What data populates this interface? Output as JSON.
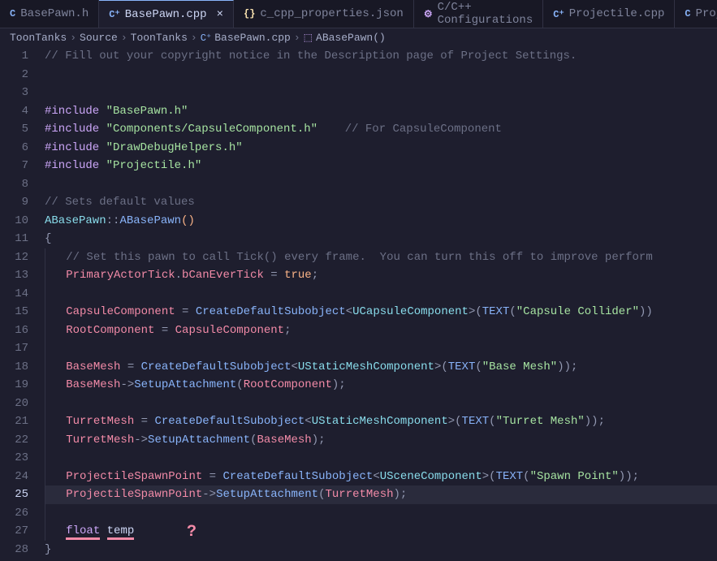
{
  "tabs": [
    {
      "icon": "C",
      "label": "BasePawn.h",
      "active": false
    },
    {
      "icon": "C⁺",
      "label": "BasePawn.cpp",
      "active": true,
      "close": "×"
    },
    {
      "icon": "{}",
      "label": "c_cpp_properties.json",
      "active": false
    },
    {
      "icon": "⚙",
      "label": "C/C++ Configurations",
      "active": false
    },
    {
      "icon": "C⁺",
      "label": "Projectile.cpp",
      "active": false
    },
    {
      "icon": "C",
      "label": "Projectile.",
      "active": false
    }
  ],
  "breadcrumb": {
    "parts": [
      "ToonTanks",
      "Source",
      "ToonTanks"
    ],
    "file": "BasePawn.cpp",
    "symbol": "ABasePawn()"
  },
  "code": {
    "lines": [
      {
        "n": 1,
        "tokens": [
          {
            "t": "// Fill out your copyright notice in the Description page of Project Settings.",
            "c": "comment"
          }
        ]
      },
      {
        "n": 2,
        "tokens": []
      },
      {
        "n": 3,
        "tokens": []
      },
      {
        "n": 4,
        "tokens": [
          {
            "t": "#include ",
            "c": "preprocessor"
          },
          {
            "t": "\"BasePawn.h\"",
            "c": "string"
          }
        ]
      },
      {
        "n": 5,
        "tokens": [
          {
            "t": "#include ",
            "c": "preprocessor"
          },
          {
            "t": "\"Components/CapsuleComponent.h\"",
            "c": "string"
          },
          {
            "t": "    ",
            "c": ""
          },
          {
            "t": "// For CapsuleComponent",
            "c": "comment"
          }
        ]
      },
      {
        "n": 6,
        "tokens": [
          {
            "t": "#include ",
            "c": "preprocessor"
          },
          {
            "t": "\"DrawDebugHelpers.h\"",
            "c": "string"
          }
        ]
      },
      {
        "n": 7,
        "tokens": [
          {
            "t": "#include ",
            "c": "preprocessor"
          },
          {
            "t": "\"Projectile.h\"",
            "c": "string"
          }
        ]
      },
      {
        "n": 8,
        "tokens": []
      },
      {
        "n": 9,
        "tokens": [
          {
            "t": "// Sets default values",
            "c": "comment"
          }
        ]
      },
      {
        "n": 10,
        "tokens": [
          {
            "t": "ABasePawn",
            "c": "class-name"
          },
          {
            "t": "::",
            "c": "punct"
          },
          {
            "t": "ABasePawn",
            "c": "func"
          },
          {
            "t": "()",
            "c": "literal"
          }
        ]
      },
      {
        "n": 11,
        "tokens": [
          {
            "t": "{",
            "c": "punct"
          }
        ]
      },
      {
        "n": 12,
        "indent": 1,
        "tokens": [
          {
            "t": "// Set this pawn to call Tick() every frame.  You can turn this off to improve perform",
            "c": "comment"
          }
        ]
      },
      {
        "n": 13,
        "indent": 1,
        "tokens": [
          {
            "t": "PrimaryActorTick",
            "c": "var"
          },
          {
            "t": ".",
            "c": "punct"
          },
          {
            "t": "bCanEverTick",
            "c": "var"
          },
          {
            "t": " = ",
            "c": "operator"
          },
          {
            "t": "true",
            "c": "literal"
          },
          {
            "t": ";",
            "c": "punct"
          }
        ]
      },
      {
        "n": 14,
        "indent": 1,
        "tokens": []
      },
      {
        "n": 15,
        "indent": 1,
        "tokens": [
          {
            "t": "CapsuleComponent",
            "c": "var"
          },
          {
            "t": " = ",
            "c": "operator"
          },
          {
            "t": "CreateDefaultSubobject",
            "c": "func"
          },
          {
            "t": "<",
            "c": "punct"
          },
          {
            "t": "UCapsuleComponent",
            "c": "class-name"
          },
          {
            "t": ">(",
            "c": "punct"
          },
          {
            "t": "TEXT",
            "c": "macro"
          },
          {
            "t": "(",
            "c": "punct"
          },
          {
            "t": "\"Capsule Collider\"",
            "c": "string"
          },
          {
            "t": "))",
            "c": "punct"
          }
        ]
      },
      {
        "n": 16,
        "indent": 1,
        "tokens": [
          {
            "t": "RootComponent",
            "c": "var"
          },
          {
            "t": " = ",
            "c": "operator"
          },
          {
            "t": "CapsuleComponent",
            "c": "var"
          },
          {
            "t": ";",
            "c": "punct"
          }
        ]
      },
      {
        "n": 17,
        "indent": 1,
        "tokens": []
      },
      {
        "n": 18,
        "indent": 1,
        "tokens": [
          {
            "t": "BaseMesh",
            "c": "var"
          },
          {
            "t": " = ",
            "c": "operator"
          },
          {
            "t": "CreateDefaultSubobject",
            "c": "func"
          },
          {
            "t": "<",
            "c": "punct"
          },
          {
            "t": "UStaticMeshComponent",
            "c": "class-name"
          },
          {
            "t": ">(",
            "c": "punct"
          },
          {
            "t": "TEXT",
            "c": "macro"
          },
          {
            "t": "(",
            "c": "punct"
          },
          {
            "t": "\"Base Mesh\"",
            "c": "string"
          },
          {
            "t": "));",
            "c": "punct"
          }
        ]
      },
      {
        "n": 19,
        "indent": 1,
        "tokens": [
          {
            "t": "BaseMesh",
            "c": "var"
          },
          {
            "t": "->",
            "c": "punct"
          },
          {
            "t": "SetupAttachment",
            "c": "func"
          },
          {
            "t": "(",
            "c": "punct"
          },
          {
            "t": "RootComponent",
            "c": "var"
          },
          {
            "t": ");",
            "c": "punct"
          }
        ]
      },
      {
        "n": 20,
        "indent": 1,
        "tokens": []
      },
      {
        "n": 21,
        "indent": 1,
        "tokens": [
          {
            "t": "TurretMesh",
            "c": "var"
          },
          {
            "t": " = ",
            "c": "operator"
          },
          {
            "t": "CreateDefaultSubobject",
            "c": "func"
          },
          {
            "t": "<",
            "c": "punct"
          },
          {
            "t": "UStaticMeshComponent",
            "c": "class-name"
          },
          {
            "t": ">(",
            "c": "punct"
          },
          {
            "t": "TEXT",
            "c": "macro"
          },
          {
            "t": "(",
            "c": "punct"
          },
          {
            "t": "\"Turret Mesh\"",
            "c": "string"
          },
          {
            "t": "));",
            "c": "punct"
          }
        ]
      },
      {
        "n": 22,
        "indent": 1,
        "tokens": [
          {
            "t": "TurretMesh",
            "c": "var"
          },
          {
            "t": "->",
            "c": "punct"
          },
          {
            "t": "SetupAttachment",
            "c": "func"
          },
          {
            "t": "(",
            "c": "punct"
          },
          {
            "t": "BaseMesh",
            "c": "var"
          },
          {
            "t": ");",
            "c": "punct"
          }
        ]
      },
      {
        "n": 23,
        "indent": 1,
        "tokens": []
      },
      {
        "n": 24,
        "indent": 1,
        "tokens": [
          {
            "t": "ProjectileSpawnPoint",
            "c": "var"
          },
          {
            "t": " = ",
            "c": "operator"
          },
          {
            "t": "CreateDefaultSubobject",
            "c": "func"
          },
          {
            "t": "<",
            "c": "punct"
          },
          {
            "t": "USceneComponent",
            "c": "class-name"
          },
          {
            "t": ">(",
            "c": "punct"
          },
          {
            "t": "TEXT",
            "c": "macro"
          },
          {
            "t": "(",
            "c": "punct"
          },
          {
            "t": "\"Spawn Point\"",
            "c": "string"
          },
          {
            "t": "));",
            "c": "punct"
          }
        ]
      },
      {
        "n": 25,
        "indent": 1,
        "cursor": true,
        "tokens": [
          {
            "t": "ProjectileSpawnPoint",
            "c": "var"
          },
          {
            "t": "->",
            "c": "punct"
          },
          {
            "t": "SetupAttachment",
            "c": "func"
          },
          {
            "t": "(",
            "c": "punct"
          },
          {
            "t": "TurretMesh",
            "c": "var"
          },
          {
            "t": ");",
            "c": "punct"
          }
        ]
      },
      {
        "n": 26,
        "indent": 1,
        "tokens": []
      },
      {
        "n": 27,
        "indent": 1,
        "tokens": [
          {
            "t": "float",
            "c": "keyword",
            "err": true
          },
          {
            "t": " ",
            "c": ""
          },
          {
            "t": "temp",
            "c": "prop",
            "err": true
          }
        ]
      },
      {
        "n": 28,
        "tokens": [
          {
            "t": "}",
            "c": "punct"
          }
        ]
      }
    ]
  },
  "annotation": "?"
}
